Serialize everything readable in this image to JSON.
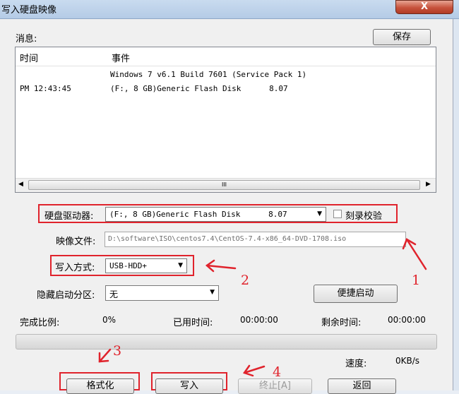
{
  "window": {
    "title": "写入硬盘映像",
    "close_glyph": "X"
  },
  "messages": {
    "label": "消息:",
    "save_button": "保存",
    "columns": [
      "时间",
      "事件"
    ],
    "rows": [
      {
        "time": "",
        "event": "Windows 7 v6.1 Build 7601 (Service Pack 1)"
      },
      {
        "time": "PM 12:43:45",
        "event": "(F:, 8 GB)Generic Flash Disk      8.07"
      }
    ],
    "scroll_thumb_glyph": "III"
  },
  "drive": {
    "label": "硬盘驱动器:",
    "value": "(F:, 8 GB)Generic Flash Disk      8.07",
    "verify_label": "刻录校验",
    "verify_checked": false
  },
  "image_file": {
    "label": "映像文件:",
    "value": "D:\\software\\ISO\\centos7.4\\CentOS-7.4-x86_64-DVD-1708.iso"
  },
  "write_method": {
    "label": "写入方式:",
    "value": "USB-HDD+"
  },
  "hidden_partition": {
    "label": "隐藏启动分区:",
    "value": "无"
  },
  "quick_boot_button": "便捷启动",
  "progress": {
    "complete_label": "完成比例:",
    "complete_value": "0%",
    "elapsed_label": "已用时间:",
    "elapsed_value": "00:00:00",
    "remaining_label": "剩余时间:",
    "remaining_value": "00:00:00",
    "fraction": 0
  },
  "speed": {
    "label": "速度:",
    "value": "0KB/s"
  },
  "buttons": {
    "format": "格式化",
    "write": "写入",
    "stop": "终止[A]",
    "back": "返回"
  },
  "annotations": [
    "1",
    "2",
    "3",
    "4"
  ],
  "colors": {
    "annotation_red": "#e0232c"
  }
}
